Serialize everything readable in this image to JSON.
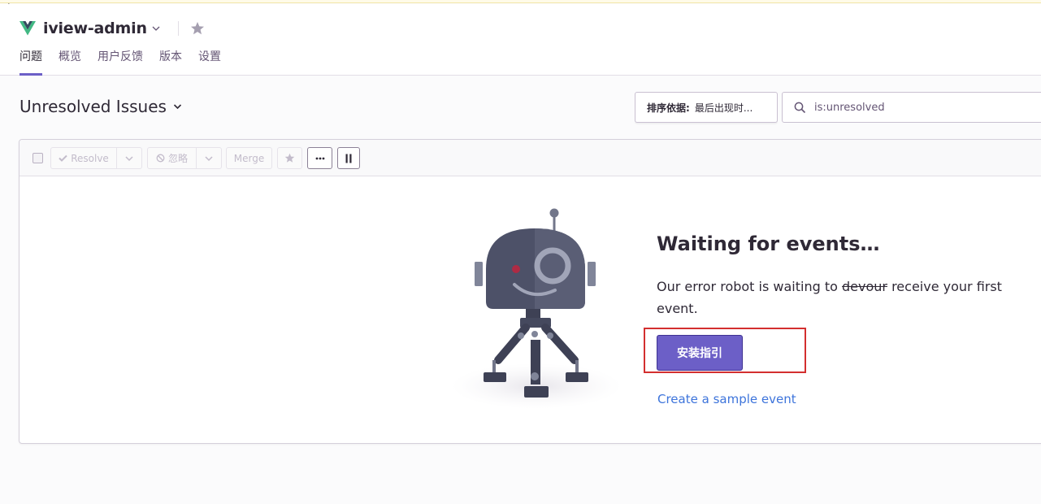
{
  "project": {
    "name": "iview-admin"
  },
  "tabs": [
    {
      "label": "问题",
      "active": true
    },
    {
      "label": "概览"
    },
    {
      "label": "用户反馈"
    },
    {
      "label": "版本"
    },
    {
      "label": "设置"
    }
  ],
  "page": {
    "title": "Unresolved Issues"
  },
  "sort": {
    "label": "排序依据:",
    "value": "最后出现时..."
  },
  "search": {
    "value": "is:unresolved"
  },
  "toolbar": {
    "resolve": "Resolve",
    "ignore": "忽略",
    "merge": "Merge"
  },
  "empty": {
    "title": "Waiting for events…",
    "desc_before": "Our error robot is waiting to ",
    "desc_strike": "devour",
    "desc_after": " receive your first event.",
    "install_button": "安装指引",
    "sample_link": "Create a sample event"
  },
  "colors": {
    "accent": "#6c5fc7",
    "link": "#3d74db",
    "highlight": "#d32f2f"
  },
  "icons": [
    "vue-logo-icon",
    "chevron-down-icon",
    "star-icon",
    "search-icon",
    "check-icon",
    "ignore-icon",
    "ellipsis-icon",
    "pause-icon",
    "robot-illustration",
    "cursor-icon"
  ]
}
